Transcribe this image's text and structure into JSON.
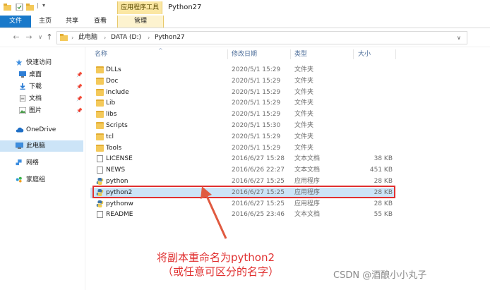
{
  "window": {
    "title": "Python27",
    "tool_tab": "应用程序工具",
    "ribbon_tabs": [
      "文件",
      "主页",
      "共享",
      "查看",
      "管理"
    ]
  },
  "navigation": {
    "back": "←",
    "forward": "→",
    "recent": "∨",
    "up": "↑",
    "breadcrumbs": [
      "此电脑",
      "DATA (D:)",
      "Python27"
    ]
  },
  "sidebar": {
    "items": [
      {
        "label": "快速访问",
        "icon": "star-icon",
        "pin": false
      },
      {
        "label": "桌面",
        "icon": "desktop-icon",
        "pin": true
      },
      {
        "label": "下载",
        "icon": "download-icon",
        "pin": true
      },
      {
        "label": "文档",
        "icon": "document-icon",
        "pin": true
      },
      {
        "label": "图片",
        "icon": "picture-icon",
        "pin": true
      },
      {
        "label": "OneDrive",
        "icon": "cloud-icon",
        "pin": false
      },
      {
        "label": "此电脑",
        "icon": "computer-icon",
        "pin": false,
        "selected": true
      },
      {
        "label": "网络",
        "icon": "network-icon",
        "pin": false
      },
      {
        "label": "家庭组",
        "icon": "homegroup-icon",
        "pin": false
      }
    ]
  },
  "columns": {
    "name": "名称",
    "date": "修改日期",
    "type": "类型",
    "size": "大小"
  },
  "files": [
    {
      "name": "DLLs",
      "date": "2020/5/1 15:29",
      "type": "文件夹",
      "size": "",
      "kind": "folder"
    },
    {
      "name": "Doc",
      "date": "2020/5/1 15:29",
      "type": "文件夹",
      "size": "",
      "kind": "folder"
    },
    {
      "name": "include",
      "date": "2020/5/1 15:29",
      "type": "文件夹",
      "size": "",
      "kind": "folder"
    },
    {
      "name": "Lib",
      "date": "2020/5/1 15:29",
      "type": "文件夹",
      "size": "",
      "kind": "folder"
    },
    {
      "name": "libs",
      "date": "2020/5/1 15:29",
      "type": "文件夹",
      "size": "",
      "kind": "folder"
    },
    {
      "name": "Scripts",
      "date": "2020/5/1 15:30",
      "type": "文件夹",
      "size": "",
      "kind": "folder"
    },
    {
      "name": "tcl",
      "date": "2020/5/1 15:29",
      "type": "文件夹",
      "size": "",
      "kind": "folder"
    },
    {
      "name": "Tools",
      "date": "2020/5/1 15:29",
      "type": "文件夹",
      "size": "",
      "kind": "folder"
    },
    {
      "name": "LICENSE",
      "date": "2016/6/27 15:28",
      "type": "文本文档",
      "size": "38 KB",
      "kind": "doc"
    },
    {
      "name": "NEWS",
      "date": "2016/6/26 22:27",
      "type": "文本文档",
      "size": "451 KB",
      "kind": "doc"
    },
    {
      "name": "python",
      "date": "2016/6/27 15:25",
      "type": "应用程序",
      "size": "28 KB",
      "kind": "py"
    },
    {
      "name": "python2",
      "date": "2016/6/27 15:25",
      "type": "应用程序",
      "size": "28 KB",
      "kind": "py",
      "highlighted": true
    },
    {
      "name": "pythonw",
      "date": "2016/6/27 15:25",
      "type": "应用程序",
      "size": "28 KB",
      "kind": "py"
    },
    {
      "name": "README",
      "date": "2016/6/25 23:46",
      "type": "文本文档",
      "size": "55 KB",
      "kind": "doc"
    }
  ],
  "annotation": {
    "line1": "将副本重命名为python2",
    "line2": "（或任意可区分的名字）",
    "color": "#e03030"
  },
  "watermark": "CSDN @酒酿小小丸子"
}
